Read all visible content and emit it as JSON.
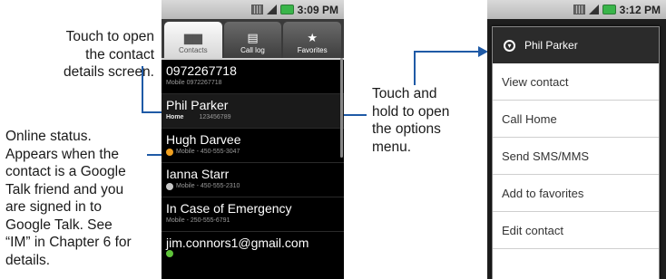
{
  "callouts": {
    "open_details": [
      "Touch to open",
      "the contact",
      "details screen."
    ],
    "online_status": [
      "Online status.",
      "Appears when the",
      "contact is a Google",
      "Talk friend and you",
      "are signed in to",
      "Google Talk. See",
      "“IM” in Chapter 6 for",
      "details."
    ],
    "options_menu": [
      "Touch and",
      "hold to open",
      "the options",
      "menu."
    ]
  },
  "phone1": {
    "time": "3:09 PM",
    "tabs": [
      {
        "label": "Contacts",
        "icon": "contacts-icon",
        "active": true
      },
      {
        "label": "Call log",
        "icon": "call-log-icon",
        "active": false
      },
      {
        "label": "Favorites",
        "icon": "star-icon",
        "active": false
      }
    ],
    "contacts": [
      {
        "name": "0972267718",
        "sub": "Mobile 0972267718"
      },
      {
        "name": "Phil Parker",
        "label": "Home",
        "number": "123456789"
      },
      {
        "name": "Hugh Darvee",
        "sub": "Mobile - 450-555-3047",
        "status": "away",
        "status_color": "#f0a020"
      },
      {
        "name": "Ianna Starr",
        "sub": "Mobile - 450-555-2310",
        "status": "idle",
        "status_color": "#c8c8c8"
      },
      {
        "name": "In Case of Emergency",
        "sub": "Mobile - 250-555-6791"
      },
      {
        "name": "jim.connors1@gmail.com",
        "status": "online",
        "status_color": "#5fc43a"
      }
    ]
  },
  "phone2": {
    "time": "3:12 PM",
    "menu_title": "Phil Parker",
    "menu_items": [
      "View contact",
      "Call Home",
      "Send SMS/MMS",
      "Add to favorites",
      "Edit contact"
    ]
  },
  "colors": {
    "callout_line": "#1f5aa6",
    "battery": "#39b54a"
  }
}
